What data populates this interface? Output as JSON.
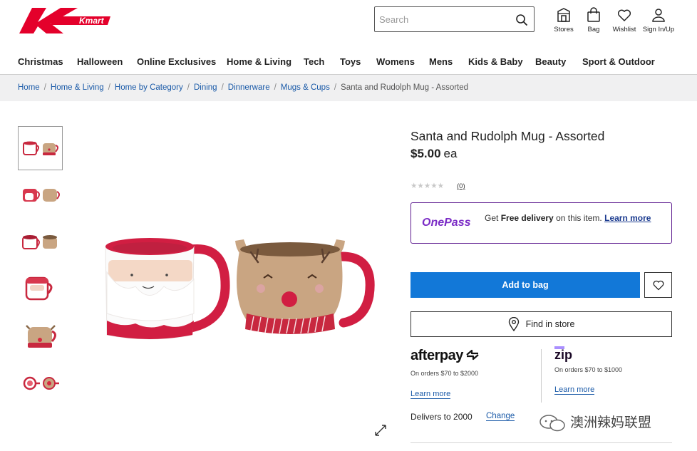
{
  "header": {
    "logo_text": "Kmart",
    "search_placeholder": "Search",
    "utility": [
      {
        "label": "Stores",
        "icon": "store-icon"
      },
      {
        "label": "Bag",
        "icon": "bag-icon"
      },
      {
        "label": "Wishlist",
        "icon": "heart-icon"
      },
      {
        "label": "Sign In/Up",
        "icon": "user-icon"
      }
    ]
  },
  "nav": [
    "Christmas",
    "Halloween",
    "Online Exclusives",
    "Home & Living",
    "Tech",
    "Toys",
    "Womens",
    "Mens",
    "Kids & Baby",
    "Beauty",
    "Sport & Outdoor"
  ],
  "breadcrumb": [
    "Home",
    "Home & Living",
    "Home by Category",
    "Dining",
    "Dinnerware",
    "Mugs & Cups",
    "Santa and Rudolph Mug - Assorted"
  ],
  "product": {
    "title": "Santa and Rudolph Mug - Assorted",
    "price": "$5.00",
    "price_unit": "ea",
    "stars": "★★★★★",
    "rating_count": "(0)",
    "onepass": {
      "brand": "OnePass",
      "prefix": "Get ",
      "highlight": "Free delivery",
      "suffix": " on this item. ",
      "link": "Learn more"
    },
    "add_to_bag": "Add to bag",
    "find_in_store": "Find in store",
    "afterpay": {
      "brand": "afterpay",
      "text": "On orders $70 to $2000",
      "link": "Learn more"
    },
    "zip": {
      "brand": "zip",
      "text": "On orders $70 to $1000",
      "link": "Learn more"
    },
    "delivers_to": "Delivers to 2000",
    "change": "Change"
  },
  "watermark": "澳洲辣妈联盟",
  "colors": {
    "brand_red": "#e4002b",
    "primary_blue": "#1278d8",
    "onepass_purple": "#7b2cc6",
    "link_blue": "#1a5aa8"
  }
}
